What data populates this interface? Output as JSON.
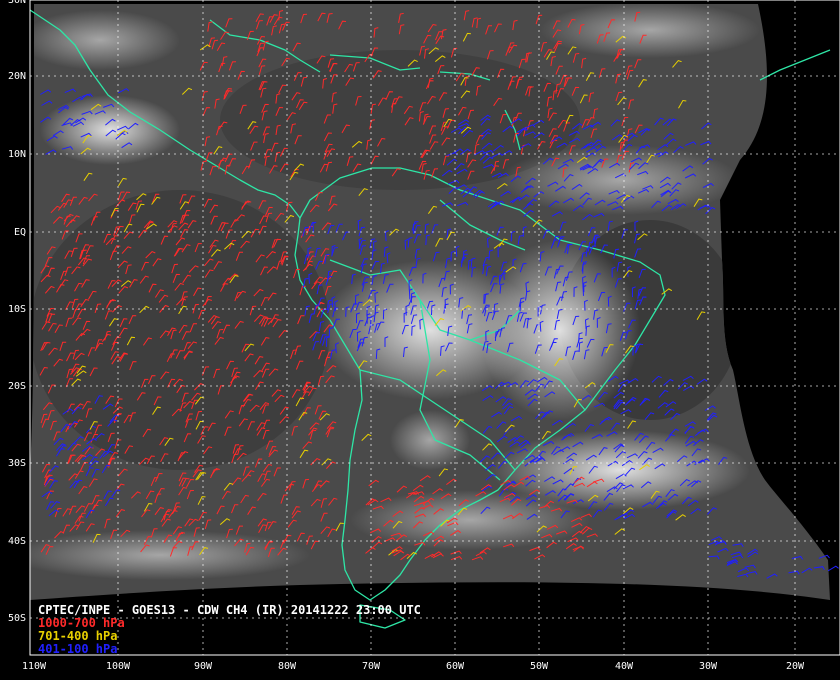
{
  "title": "CPTEC/INPE - GOES13 - CDW CH4 (IR) 20141222 23:00 UTC",
  "legend": [
    {
      "label": "1000-700 hPa",
      "color": "#ff2a2a"
    },
    {
      "label": "701-400 hPa",
      "color": "#e8d000"
    },
    {
      "label": "401-100 hPa",
      "color": "#2020ff"
    }
  ],
  "lat_labels": [
    "30N",
    "20N",
    "10N",
    "EQ",
    "10S",
    "20S",
    "30S",
    "40S",
    "50S"
  ],
  "lon_labels": [
    "110W",
    "100W",
    "90W",
    "80W",
    "70W",
    "60W",
    "50W",
    "40W",
    "30W",
    "20W"
  ],
  "colors": {
    "coastline": "#2ee6a6",
    "grid": "#ffffff",
    "background": "#000000"
  }
}
